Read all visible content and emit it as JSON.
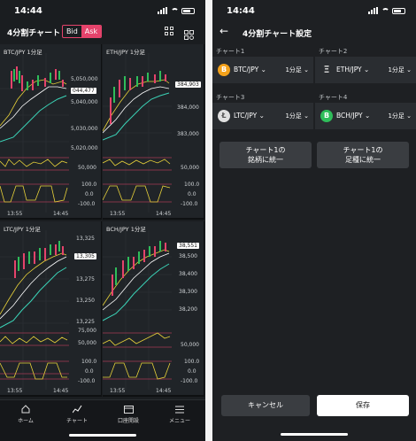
{
  "left": {
    "status_time": "14:44",
    "title": "4分割チャート",
    "bid_label": "Bid",
    "ask_label": "Ask",
    "charts": [
      {
        "label": "BTC/JPY  1分足",
        "tag": "044,477",
        "prices": [
          "5,050,000",
          "5,040,000",
          "5,030,000",
          "5,020,000"
        ],
        "osc1": [
          "50,000"
        ],
        "osc2": [
          "100.0",
          "0.0",
          "-100.0"
        ],
        "x_ticks": [
          "13:55",
          "14:45"
        ]
      },
      {
        "label": "ETH/JPY  1分足",
        "tag": "384,903",
        "prices": [
          "384,000",
          "383,000"
        ],
        "osc1": [
          "50,000"
        ],
        "osc2": [
          "100.0",
          "0.0",
          "-100.0"
        ],
        "x_ticks": [
          "13:55",
          "14:45"
        ]
      },
      {
        "label": "LTC/JPY  1分足",
        "tag": "13,305",
        "prices": [
          "13,325",
          "13,275",
          "13,250",
          "13,225"
        ],
        "osc1": [
          "75,000",
          "50,000"
        ],
        "osc2": [
          "100.0",
          "0.0",
          "-100.0"
        ],
        "x_ticks": [
          "13:55",
          "14:45"
        ]
      },
      {
        "label": "BCH/JPY  1分足",
        "tag": "38,551",
        "prices": [
          "38,500",
          "38,400",
          "38,300",
          "38,200"
        ],
        "osc1": [
          "50,000"
        ],
        "osc2": [
          "100.0",
          "0.0",
          "-100.0"
        ],
        "x_ticks": [
          "13:55",
          "14:45"
        ]
      }
    ],
    "tabs": [
      {
        "label": "ホーム",
        "icon": "home-icon"
      },
      {
        "label": "チャート",
        "icon": "chart-icon"
      },
      {
        "label": "口座開設",
        "icon": "card-icon"
      },
      {
        "label": "メニュー",
        "icon": "menu-icon"
      }
    ]
  },
  "right": {
    "status_time": "14:44",
    "title": "4分割チャート設定",
    "slots": [
      {
        "label": "チャート1",
        "pair": "BTC/JPY",
        "timeframe": "1分足",
        "coin": "B",
        "color": "#f4a21b"
      },
      {
        "label": "チャート2",
        "pair": "ETH/JPY",
        "timeframe": "1分足",
        "coin": "Ξ",
        "color": "#8c8c8c"
      },
      {
        "label": "チャート3",
        "pair": "LTC/JPY",
        "timeframe": "1分足",
        "coin": "Ł",
        "color": "#b9b9b9"
      },
      {
        "label": "チャート4",
        "pair": "BCH/JPY",
        "timeframe": "1分足",
        "coin": "B",
        "color": "#2fbd5a"
      }
    ],
    "unify_pair_line1": "チャート1の",
    "unify_pair_line2": "銘柄に統一",
    "unify_tf_line1": "チャート1の",
    "unify_tf_line2": "足種に統一",
    "cancel_label": "キャンセル",
    "save_label": "保存"
  }
}
